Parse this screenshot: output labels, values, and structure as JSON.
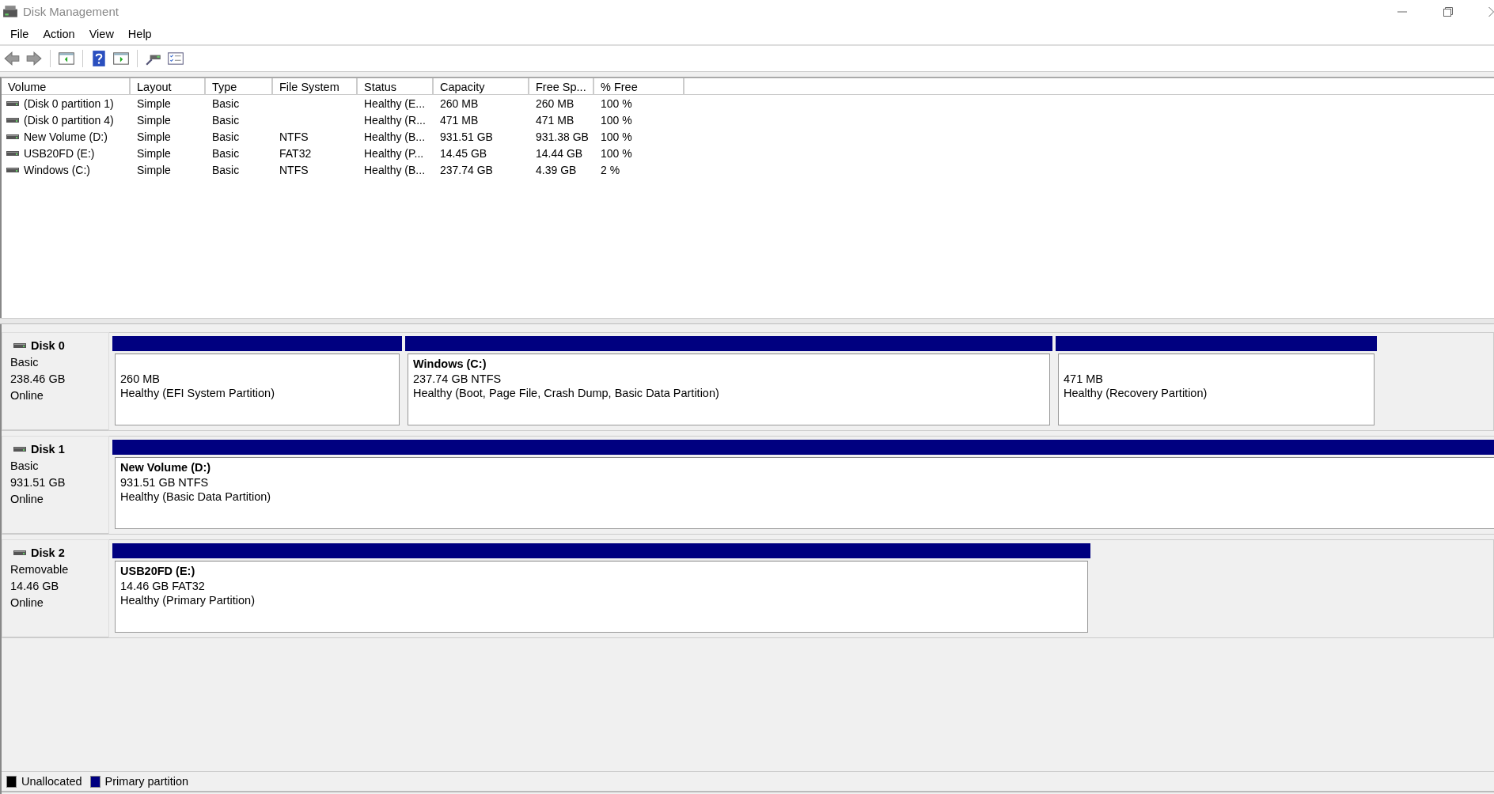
{
  "window": {
    "title": "Disk Management"
  },
  "menu": [
    "File",
    "Action",
    "View",
    "Help"
  ],
  "table": {
    "columns": [
      "Volume",
      "Layout",
      "Type",
      "File System",
      "Status",
      "Capacity",
      "Free Sp...",
      "% Free"
    ],
    "rows": [
      {
        "cells": [
          "(Disk 0 partition 1)",
          "Simple",
          "Basic",
          "",
          "Healthy (E...",
          "260 MB",
          "260 MB",
          "100 %"
        ]
      },
      {
        "cells": [
          "(Disk 0 partition 4)",
          "Simple",
          "Basic",
          "",
          "Healthy (R...",
          "471 MB",
          "471 MB",
          "100 %"
        ]
      },
      {
        "cells": [
          "New Volume (D:)",
          "Simple",
          "Basic",
          "NTFS",
          "Healthy (B...",
          "931.51 GB",
          "931.38 GB",
          "100 %"
        ]
      },
      {
        "cells": [
          "USB20FD (E:)",
          "Simple",
          "Basic",
          "FAT32",
          "Healthy (P...",
          "14.45 GB",
          "14.44 GB",
          "100 %"
        ]
      },
      {
        "cells": [
          "Windows (C:)",
          "Simple",
          "Basic",
          "NTFS",
          "Healthy (B...",
          "237.74 GB",
          "4.39 GB",
          "2 %"
        ]
      }
    ]
  },
  "disks": [
    {
      "name": "Disk 0",
      "type": "Basic",
      "size": "238.46 GB",
      "state": "Online",
      "partitions": [
        {
          "size": "260 MB",
          "status": "Healthy (EFI System Partition)"
        },
        {
          "name": "Windows  (C:)",
          "size": "237.74 GB NTFS",
          "status": "Healthy (Boot, Page File, Crash Dump, Basic Data Partition)"
        },
        {
          "size": "471 MB",
          "status": "Healthy (Recovery Partition)"
        }
      ]
    },
    {
      "name": "Disk 1",
      "type": "Basic",
      "size": "931.51 GB",
      "state": "Online",
      "partitions": [
        {
          "name": "New Volume  (D:)",
          "size": "931.51 GB NTFS",
          "status": "Healthy (Basic Data Partition)"
        }
      ]
    },
    {
      "name": "Disk 2",
      "type": "Removable",
      "size": "14.46 GB",
      "state": "Online",
      "partitions": [
        {
          "name": "USB20FD  (E:)",
          "size": "14.46 GB FAT32",
          "status": "Healthy (Primary Partition)"
        }
      ]
    }
  ],
  "legend": [
    {
      "label": "Unallocated",
      "color": "#000000"
    },
    {
      "label": "Primary partition",
      "color": "#000080"
    }
  ]
}
